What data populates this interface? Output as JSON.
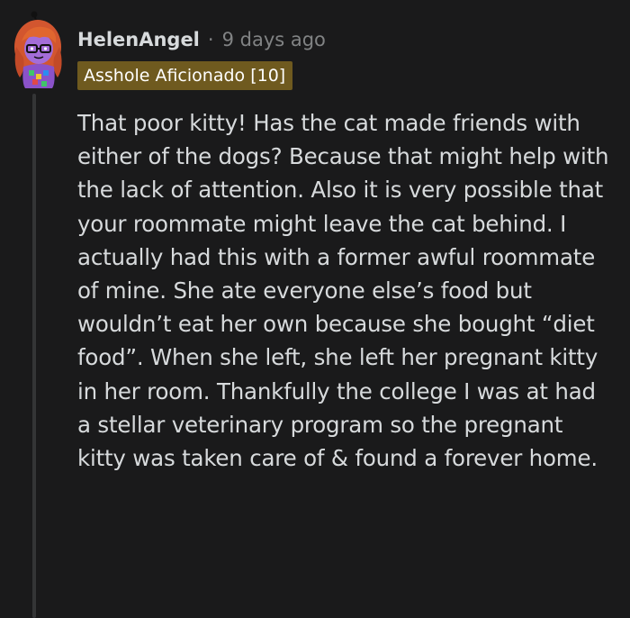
{
  "comment": {
    "username": "HelenAngel",
    "separator": "·",
    "time_ago": "9 days ago",
    "flair": "Asshole Aficionado [10]",
    "body": "That poor kitty! Has the cat made friends with either of the dogs? Because that might help with the lack of attention. Also it is very possible that your roommate might leave the cat behind. I actually had this with a former awful roommate of mine. She ate everyone else’s food but wouldn’t eat her own because she bought “diet food”. When she left, she left her pregnant kitty in her room. Thankfully the college I was at had a stellar veterinary program so the pregnant kitty was taken care of & found a forever home."
  },
  "colors": {
    "background": "#1a1a1b",
    "flair_background": "#6f5a1f",
    "text": "#d7dadc",
    "meta_text": "#818384",
    "thread_line": "#343536"
  },
  "icons": {
    "avatar": "avatar-icon"
  }
}
